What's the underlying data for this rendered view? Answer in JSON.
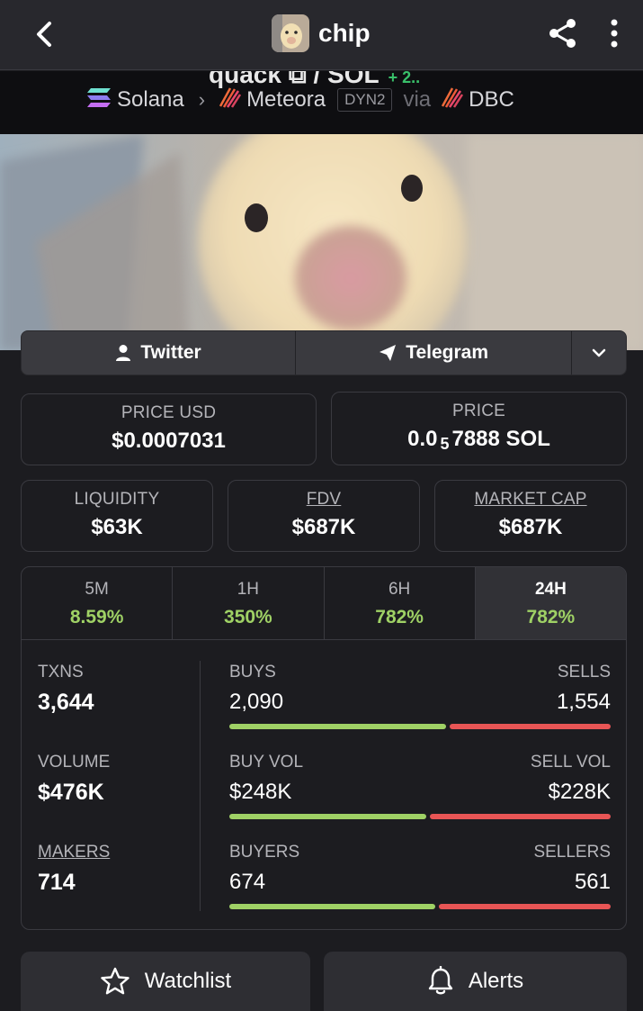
{
  "header": {
    "title": "chip",
    "back_icon": "chevron-left-icon",
    "share_icon": "share-icon",
    "more_icon": "more-vertical-icon"
  },
  "subheader": {
    "pair_text": "quack ⧉ / SOL",
    "pair_change": "+ 2..",
    "chain": "Solana",
    "dex": "Meteora",
    "dex_tag": "DYN2",
    "via": "via",
    "launchpad": "DBC"
  },
  "links": {
    "twitter": "Twitter",
    "telegram": "Telegram"
  },
  "prices": {
    "price_usd_label": "PRICE USD",
    "price_usd_value": "$0.0007031",
    "price_label": "PRICE",
    "price_prefix": "0.0",
    "price_sub": "5",
    "price_suffix": "7888 SOL"
  },
  "metrics": {
    "liquidity_label": "LIQUIDITY",
    "liquidity_value": "$63K",
    "fdv_label": "FDV",
    "fdv_value": "$687K",
    "mcap_label": "MARKET CAP",
    "mcap_value": "$687K"
  },
  "timeframes": [
    {
      "label": "5M",
      "value": "8.59%",
      "active": false
    },
    {
      "label": "1H",
      "value": "350%",
      "active": false
    },
    {
      "label": "6H",
      "value": "782%",
      "active": false
    },
    {
      "label": "24H",
      "value": "782%",
      "active": true
    }
  ],
  "stats": {
    "txns_label": "TXNS",
    "txns_value": "3,644",
    "volume_label": "VOLUME",
    "volume_value": "$476K",
    "makers_label": "MAKERS",
    "makers_value": "714",
    "buys_label": "BUYS",
    "buys_value": "2,090",
    "sells_label": "SELLS",
    "sells_value": "1,554",
    "buy_vol_label": "BUY VOL",
    "buy_vol_value": "$248K",
    "sell_vol_label": "SELL VOL",
    "sell_vol_value": "$228K",
    "buyers_label": "BUYERS",
    "buyers_value": "674",
    "sellers_label": "SELLERS",
    "sellers_value": "561",
    "buys_ratio": 0.574,
    "buy_vol_ratio": 0.521,
    "buyers_ratio": 0.546
  },
  "actions": {
    "watchlist": "Watchlist",
    "alerts": "Alerts"
  },
  "colors": {
    "positive": "#9fd165",
    "negative": "#e85555",
    "background": "#1c1c20",
    "topbar": "#28282d"
  }
}
